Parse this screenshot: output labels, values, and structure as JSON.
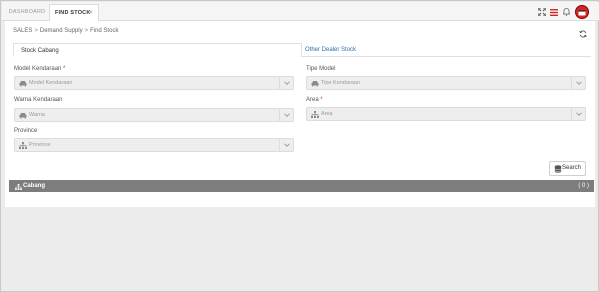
{
  "tabs": [
    {
      "label": "DASHBOARD",
      "active": false
    },
    {
      "label": "FIND STOCK",
      "active": true
    }
  ],
  "tab_close_glyph": "×",
  "toolbar_icons": [
    "expand-icon",
    "hamburger-menu-icon",
    "bell-icon",
    "user-avatar-icon"
  ],
  "breadcrumb": {
    "items": [
      "SALES",
      "Demand Supply",
      "Find Stock"
    ],
    "separator": ">"
  },
  "subtabs": {
    "stock_cabang": "Stock Cabang",
    "other_dealer": "Other Dealer Stock"
  },
  "form": {
    "model_kendaraan": {
      "label": "Model Kendaraan",
      "required_mark": "*",
      "placeholder": "Model Kendaraan",
      "icon": "car-icon"
    },
    "tipe_model": {
      "label": "Tipe Model",
      "placeholder": "Tipe Kendaraan",
      "icon": "car-icon"
    },
    "warna_kendaraan": {
      "label": "Warna Kendaraan",
      "placeholder": "Warna",
      "icon": "car-icon"
    },
    "area": {
      "label": "Area",
      "required_mark": "*",
      "placeholder": "Area",
      "icon": "sitemap-icon"
    },
    "province": {
      "label": "Province",
      "placeholder": "Province",
      "icon": "sitemap-icon"
    }
  },
  "search_button": "Search",
  "cabang": {
    "title": "Cabang",
    "count": "( 0 )"
  },
  "colors": {
    "accent_red": "#d42626",
    "link_blue": "#2f6ea8",
    "bar_grey": "#7d7d7d"
  }
}
